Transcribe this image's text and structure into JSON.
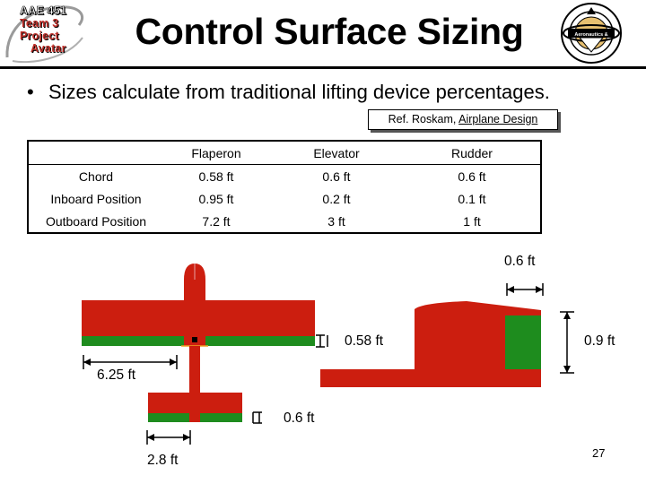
{
  "logo": {
    "line1": "AAE 451",
    "line2": "Team 3",
    "line3": "Project",
    "line4": "Avatar"
  },
  "seal": {
    "icon": "purdue-aeronautics-seal-icon",
    "top_text": "Purdue University",
    "middle_text": "Aeronautics &",
    "bottom_text": "Astronautics"
  },
  "title": "Control Surface Sizing",
  "bullet": "Sizes calculate from traditional lifting device percentages.",
  "reference": {
    "prefix": "Ref. Roskam, ",
    "book": "Airplane Design"
  },
  "table": {
    "headers": [
      "",
      "Flaperon",
      "Elevator",
      "Rudder"
    ],
    "rows": [
      {
        "label": "Chord",
        "values": [
          "0.58 ft",
          "0.6 ft",
          "0.6 ft"
        ]
      },
      {
        "label": "Inboard Position",
        "values": [
          "0.95 ft",
          "0.2 ft",
          "0.1 ft"
        ]
      },
      {
        "label": "Outboard Position",
        "values": [
          "7.2 ft",
          "3 ft",
          "1 ft"
        ]
      }
    ]
  },
  "diagram": {
    "colors": {
      "surface": "#cc1e0f",
      "control": "#1e8c1e",
      "accent": "#f0a020"
    },
    "labels": {
      "flaperon_chord": "0.58 ft",
      "wing_span_half": "6.25 ft",
      "elevator_chord": "0.6 ft",
      "elevator_span": "2.8 ft",
      "rudder_chord": "0.6 ft",
      "rudder_height": "0.9 ft"
    }
  },
  "page_number": "27"
}
